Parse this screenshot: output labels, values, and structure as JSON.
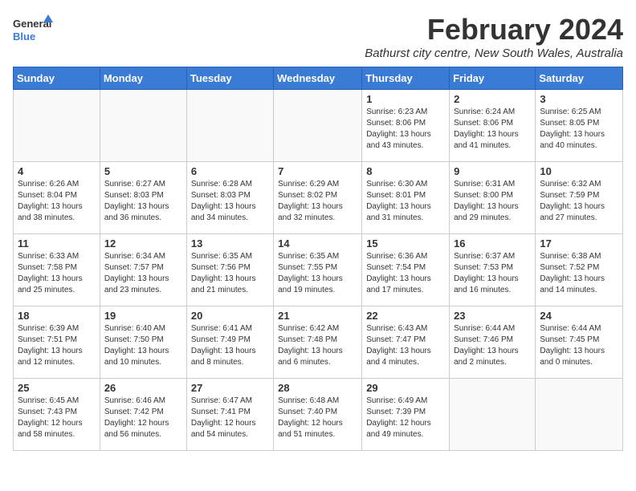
{
  "logo": {
    "general": "General",
    "blue": "Blue"
  },
  "title": "February 2024",
  "subtitle": "Bathurst city centre, New South Wales, Australia",
  "days_of_week": [
    "Sunday",
    "Monday",
    "Tuesday",
    "Wednesday",
    "Thursday",
    "Friday",
    "Saturday"
  ],
  "weeks": [
    [
      {
        "day": "",
        "info": ""
      },
      {
        "day": "",
        "info": ""
      },
      {
        "day": "",
        "info": ""
      },
      {
        "day": "",
        "info": ""
      },
      {
        "day": "1",
        "info": "Sunrise: 6:23 AM\nSunset: 8:06 PM\nDaylight: 13 hours\nand 43 minutes."
      },
      {
        "day": "2",
        "info": "Sunrise: 6:24 AM\nSunset: 8:06 PM\nDaylight: 13 hours\nand 41 minutes."
      },
      {
        "day": "3",
        "info": "Sunrise: 6:25 AM\nSunset: 8:05 PM\nDaylight: 13 hours\nand 40 minutes."
      }
    ],
    [
      {
        "day": "4",
        "info": "Sunrise: 6:26 AM\nSunset: 8:04 PM\nDaylight: 13 hours\nand 38 minutes."
      },
      {
        "day": "5",
        "info": "Sunrise: 6:27 AM\nSunset: 8:03 PM\nDaylight: 13 hours\nand 36 minutes."
      },
      {
        "day": "6",
        "info": "Sunrise: 6:28 AM\nSunset: 8:03 PM\nDaylight: 13 hours\nand 34 minutes."
      },
      {
        "day": "7",
        "info": "Sunrise: 6:29 AM\nSunset: 8:02 PM\nDaylight: 13 hours\nand 32 minutes."
      },
      {
        "day": "8",
        "info": "Sunrise: 6:30 AM\nSunset: 8:01 PM\nDaylight: 13 hours\nand 31 minutes."
      },
      {
        "day": "9",
        "info": "Sunrise: 6:31 AM\nSunset: 8:00 PM\nDaylight: 13 hours\nand 29 minutes."
      },
      {
        "day": "10",
        "info": "Sunrise: 6:32 AM\nSunset: 7:59 PM\nDaylight: 13 hours\nand 27 minutes."
      }
    ],
    [
      {
        "day": "11",
        "info": "Sunrise: 6:33 AM\nSunset: 7:58 PM\nDaylight: 13 hours\nand 25 minutes."
      },
      {
        "day": "12",
        "info": "Sunrise: 6:34 AM\nSunset: 7:57 PM\nDaylight: 13 hours\nand 23 minutes."
      },
      {
        "day": "13",
        "info": "Sunrise: 6:35 AM\nSunset: 7:56 PM\nDaylight: 13 hours\nand 21 minutes."
      },
      {
        "day": "14",
        "info": "Sunrise: 6:35 AM\nSunset: 7:55 PM\nDaylight: 13 hours\nand 19 minutes."
      },
      {
        "day": "15",
        "info": "Sunrise: 6:36 AM\nSunset: 7:54 PM\nDaylight: 13 hours\nand 17 minutes."
      },
      {
        "day": "16",
        "info": "Sunrise: 6:37 AM\nSunset: 7:53 PM\nDaylight: 13 hours\nand 16 minutes."
      },
      {
        "day": "17",
        "info": "Sunrise: 6:38 AM\nSunset: 7:52 PM\nDaylight: 13 hours\nand 14 minutes."
      }
    ],
    [
      {
        "day": "18",
        "info": "Sunrise: 6:39 AM\nSunset: 7:51 PM\nDaylight: 13 hours\nand 12 minutes."
      },
      {
        "day": "19",
        "info": "Sunrise: 6:40 AM\nSunset: 7:50 PM\nDaylight: 13 hours\nand 10 minutes."
      },
      {
        "day": "20",
        "info": "Sunrise: 6:41 AM\nSunset: 7:49 PM\nDaylight: 13 hours\nand 8 minutes."
      },
      {
        "day": "21",
        "info": "Sunrise: 6:42 AM\nSunset: 7:48 PM\nDaylight: 13 hours\nand 6 minutes."
      },
      {
        "day": "22",
        "info": "Sunrise: 6:43 AM\nSunset: 7:47 PM\nDaylight: 13 hours\nand 4 minutes."
      },
      {
        "day": "23",
        "info": "Sunrise: 6:44 AM\nSunset: 7:46 PM\nDaylight: 13 hours\nand 2 minutes."
      },
      {
        "day": "24",
        "info": "Sunrise: 6:44 AM\nSunset: 7:45 PM\nDaylight: 13 hours\nand 0 minutes."
      }
    ],
    [
      {
        "day": "25",
        "info": "Sunrise: 6:45 AM\nSunset: 7:43 PM\nDaylight: 12 hours\nand 58 minutes."
      },
      {
        "day": "26",
        "info": "Sunrise: 6:46 AM\nSunset: 7:42 PM\nDaylight: 12 hours\nand 56 minutes."
      },
      {
        "day": "27",
        "info": "Sunrise: 6:47 AM\nSunset: 7:41 PM\nDaylight: 12 hours\nand 54 minutes."
      },
      {
        "day": "28",
        "info": "Sunrise: 6:48 AM\nSunset: 7:40 PM\nDaylight: 12 hours\nand 51 minutes."
      },
      {
        "day": "29",
        "info": "Sunrise: 6:49 AM\nSunset: 7:39 PM\nDaylight: 12 hours\nand 49 minutes."
      },
      {
        "day": "",
        "info": ""
      },
      {
        "day": "",
        "info": ""
      }
    ]
  ]
}
